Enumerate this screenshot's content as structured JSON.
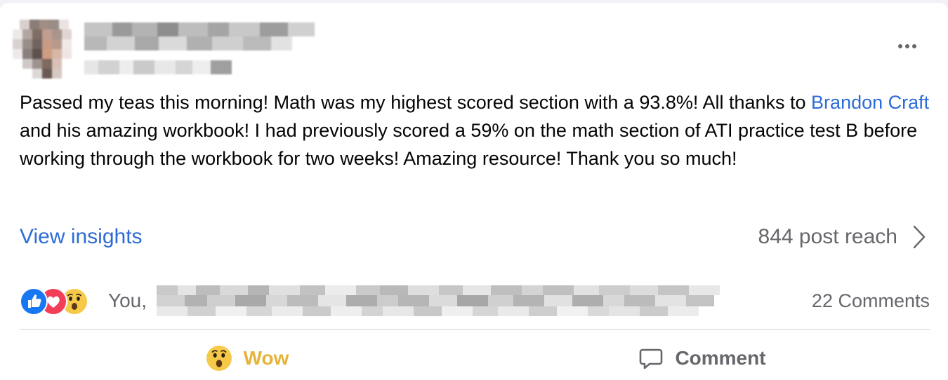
{
  "post": {
    "text_part1": "Passed my teas this morning! Math was my highest scored section with a 93.8%! All thanks to",
    "mention": "Brandon Craft",
    "text_part2": "and his amazing workbook! I had previously scored a 59% on the math section of ATI practice test B before working through the workbook for two weeks! Amazing resource! Thank you so much!"
  },
  "insights": {
    "label": "View insights",
    "reach": "844 post reach"
  },
  "reactions": {
    "icons": [
      "like-icon",
      "love-icon",
      "wow-icon"
    ],
    "prefix": "You,",
    "comments": "22 Comments"
  },
  "actions": {
    "wow": "Wow",
    "comment": "Comment"
  },
  "colors": {
    "link": "#2d6cd6",
    "wow": "#e6b33a",
    "muted": "#65676b"
  }
}
